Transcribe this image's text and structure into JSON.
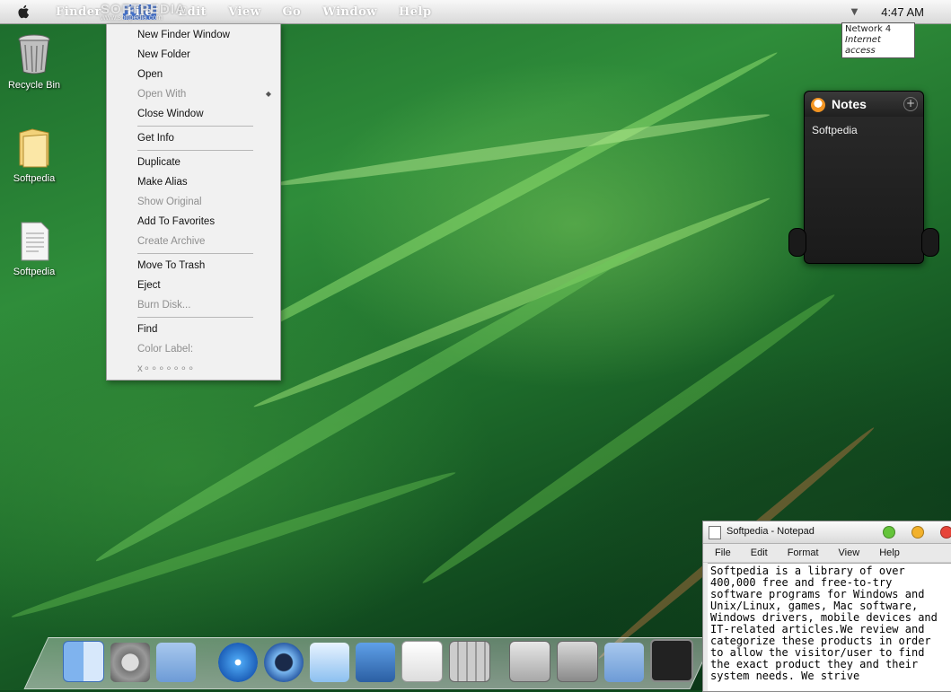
{
  "menubar": {
    "apple_icon": "apple-icon",
    "items": [
      "Finder",
      "File",
      "Edit",
      "View",
      "Go",
      "Window",
      "Help"
    ],
    "watermark": "SOFTPEDIA",
    "watermark_url": "www.softpedia.com",
    "network_icon": "network-icon",
    "clock": "4:47 AM"
  },
  "network_tooltip": {
    "title": "Network  4",
    "status": "Internet access"
  },
  "file_menu": {
    "groups": [
      [
        {
          "label": "New Finder Window",
          "enabled": true
        },
        {
          "label": "New Folder",
          "enabled": true
        },
        {
          "label": "Open",
          "enabled": true
        },
        {
          "label": "Open With",
          "enabled": false,
          "submenu": true
        },
        {
          "label": "Close Window",
          "enabled": true
        }
      ],
      [
        {
          "label": "Get Info",
          "enabled": true
        }
      ],
      [
        {
          "label": "Duplicate",
          "enabled": true
        },
        {
          "label": "Make Alias",
          "enabled": true
        },
        {
          "label": "Show Original",
          "enabled": false
        },
        {
          "label": "Add To Favorites",
          "enabled": true
        },
        {
          "label": "Create Archive",
          "enabled": false
        }
      ],
      [
        {
          "label": "Move To Trash",
          "enabled": true
        },
        {
          "label": "Eject",
          "enabled": true
        },
        {
          "label": "Burn Disk...",
          "enabled": false
        }
      ],
      [
        {
          "label": "Find",
          "enabled": true
        },
        {
          "label": "Color Label:",
          "enabled": false
        }
      ]
    ],
    "color_labels": "x∘∘∘∘∘∘∘"
  },
  "desktop_icons": [
    {
      "label": "Recycle Bin",
      "icon": "trash-icon"
    },
    {
      "label": "Softpedia",
      "icon": "folder-icon"
    },
    {
      "label": "Softpedia",
      "icon": "text-file-icon"
    }
  ],
  "notes": {
    "title": "Notes",
    "content": "Softpedia",
    "add_icon": "plus-icon"
  },
  "notepad": {
    "title": "Softpedia - Notepad",
    "menu": [
      "File",
      "Edit",
      "Format",
      "View",
      "Help"
    ],
    "text": "Softpedia is a library of over 400,000 free and free-to-try software programs for Windows and Unix/Linux, games, Mac software, Windows drivers, mobile devices and IT-related articles.We review and categorize these products in order to allow the visitor/user to find the exact product they and their system needs. We strive",
    "colors": {
      "green": "#64c43a",
      "yellow": "#f2b12b",
      "red": "#e6453a"
    }
  },
  "dock": {
    "icons": [
      "finder-icon",
      "system-preferences-icon",
      "users-folder-icon",
      "safari-icon",
      "quicktime-icon",
      "mail-icon",
      "iphoto-icon",
      "textedit-icon",
      "calculator-icon",
      "app-store-icon",
      "boot-camp-icon",
      "library-folder-icon",
      "dashboard-icon",
      "wallpaper-icon",
      "rocket-icon",
      "power-icon",
      "dock-trash-icon"
    ]
  }
}
